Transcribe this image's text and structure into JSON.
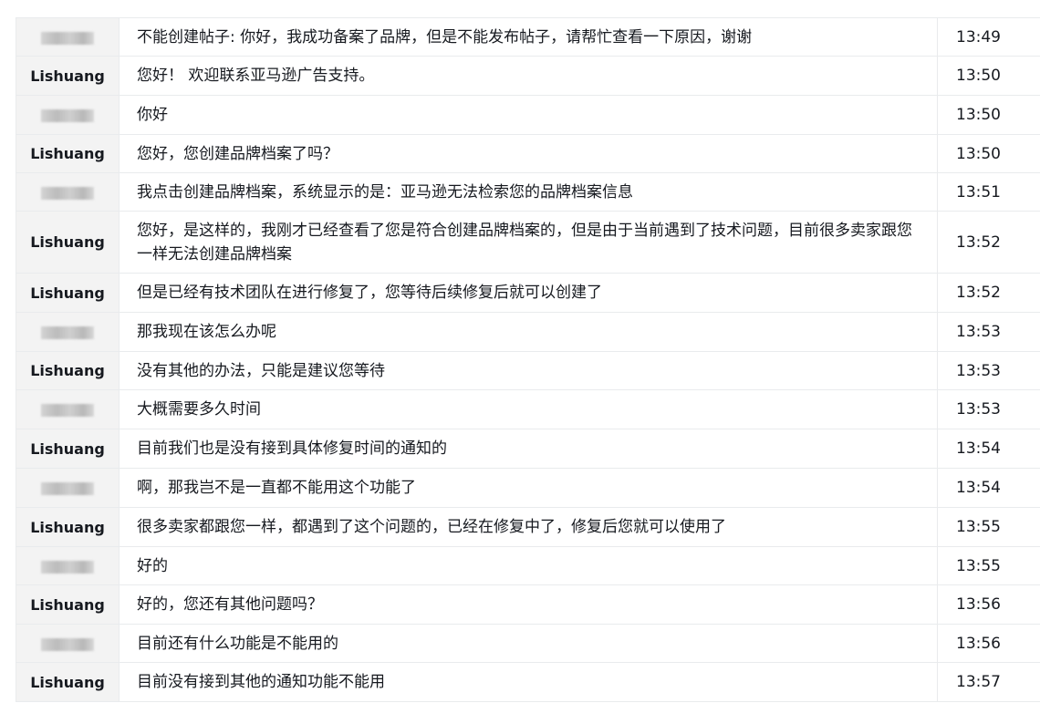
{
  "messages": [
    {
      "sender": "",
      "sender_hidden": true,
      "text": "不能创建帖子: 你好，我成功备案了品牌，但是不能发布帖子，请帮忙查看一下原因，谢谢",
      "time": "13:49"
    },
    {
      "sender": "Lishuang",
      "sender_hidden": false,
      "text": "您好！ 欢迎联系亚马逊广告支持。",
      "time": "13:50"
    },
    {
      "sender": "",
      "sender_hidden": true,
      "text": "你好",
      "time": "13:50"
    },
    {
      "sender": "Lishuang",
      "sender_hidden": false,
      "text": "您好，您创建品牌档案了吗？",
      "time": "13:50"
    },
    {
      "sender": "",
      "sender_hidden": true,
      "text": "我点击创建品牌档案，系统显示的是：亚马逊无法检索您的品牌档案信息",
      "time": "13:51"
    },
    {
      "sender": "Lishuang",
      "sender_hidden": false,
      "text": "您好，是这样的，我刚才已经查看了您是符合创建品牌档案的，但是由于当前遇到了技术问题，目前很多卖家跟您一样无法创建品牌档案",
      "time": "13:52"
    },
    {
      "sender": "Lishuang",
      "sender_hidden": false,
      "text": "但是已经有技术团队在进行修复了，您等待后续修复后就可以创建了",
      "time": "13:52"
    },
    {
      "sender": "",
      "sender_hidden": true,
      "text": "那我现在该怎么办呢",
      "time": "13:53"
    },
    {
      "sender": "Lishuang",
      "sender_hidden": false,
      "text": "没有其他的办法，只能是建议您等待",
      "time": "13:53"
    },
    {
      "sender": "",
      "sender_hidden": true,
      "text": "大概需要多久时间",
      "time": "13:53"
    },
    {
      "sender": "Lishuang",
      "sender_hidden": false,
      "text": "目前我们也是没有接到具体修复时间的通知的",
      "time": "13:54"
    },
    {
      "sender": "",
      "sender_hidden": true,
      "text": "啊，那我岂不是一直都不能用这个功能了",
      "time": "13:54"
    },
    {
      "sender": "Lishuang",
      "sender_hidden": false,
      "text": "很多卖家都跟您一样，都遇到了这个问题的，已经在修复中了，修复后您就可以使用了",
      "time": "13:55"
    },
    {
      "sender": "",
      "sender_hidden": true,
      "text": "好的",
      "time": "13:55"
    },
    {
      "sender": "Lishuang",
      "sender_hidden": false,
      "text": "好的，您还有其他问题吗？",
      "time": "13:56"
    },
    {
      "sender": "",
      "sender_hidden": true,
      "text": "目前还有什么功能是不能用的",
      "time": "13:56"
    },
    {
      "sender": "Lishuang",
      "sender_hidden": false,
      "text": "目前没有接到其他的通知功能不能用",
      "time": "13:57"
    }
  ]
}
